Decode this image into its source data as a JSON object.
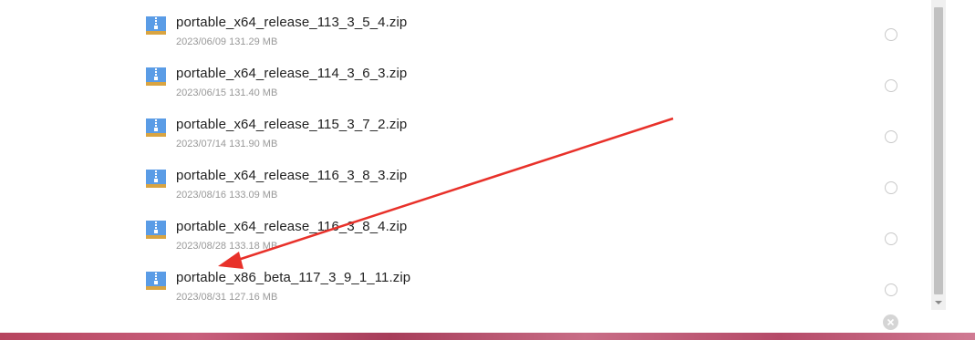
{
  "files": [
    {
      "name": "portable_x64_release_113_3_5_4.zip",
      "meta": "2023/06/09 131.29 MB"
    },
    {
      "name": "portable_x64_release_114_3_6_3.zip",
      "meta": "2023/06/15 131.40 MB"
    },
    {
      "name": "portable_x64_release_115_3_7_2.zip",
      "meta": "2023/07/14 131.90 MB"
    },
    {
      "name": "portable_x64_release_116_3_8_3.zip",
      "meta": "2023/08/16 133.09 MB"
    },
    {
      "name": "portable_x64_release_116_3_8_4.zip",
      "meta": "2023/08/28 133.18 MB"
    },
    {
      "name": "portable_x86_beta_117_3_9_1_11.zip",
      "meta": "2023/08/31 127.16 MB"
    }
  ],
  "icons": {
    "file": "zip-file-icon",
    "select": "radio-button",
    "close": "close-icon",
    "scroll": "chevron-down-icon"
  },
  "colors": {
    "arrow": "#e8312a",
    "zip_icon_blue": "#5a9ce6",
    "zip_icon_band": "#d9a441"
  }
}
